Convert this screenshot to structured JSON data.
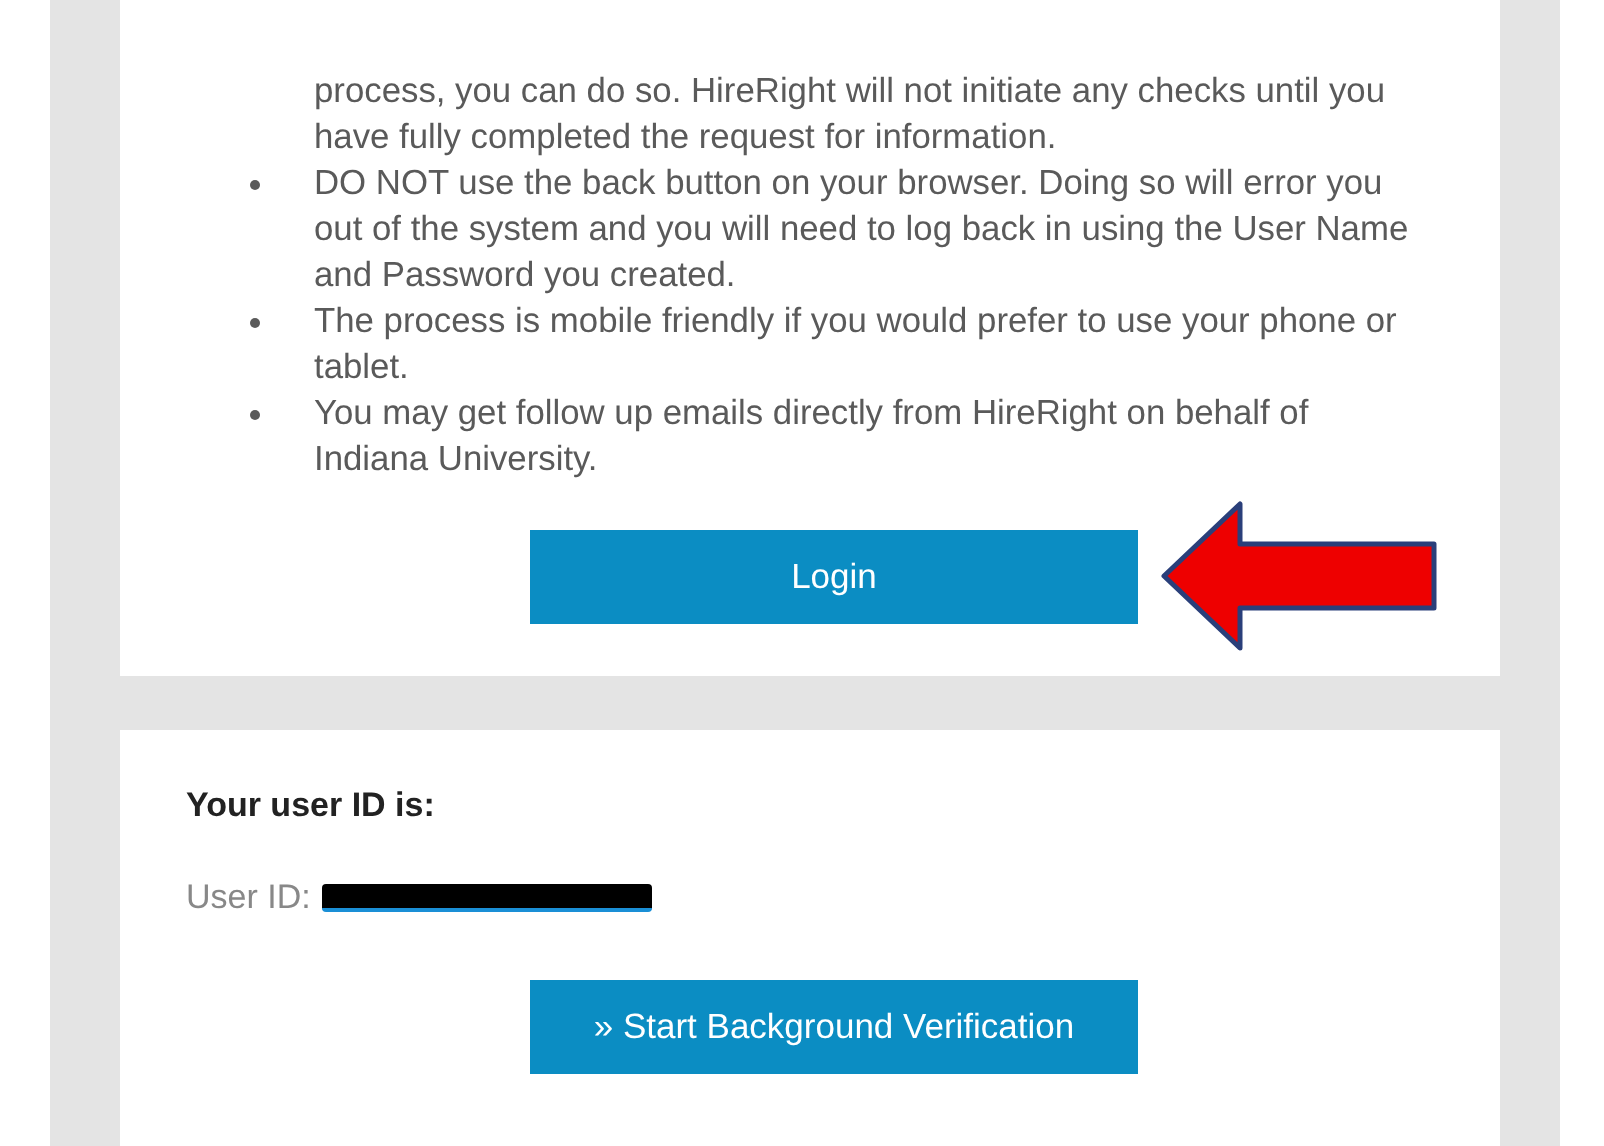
{
  "instructions": [
    {
      "text": "process, you can do so. HireRight will not initiate any checks until you have fully completed the request for information.",
      "bullet_shown": false
    },
    {
      "text": "DO NOT use the back button on your browser. Doing so will error you out of the system and you will need to log back in using the User Name and Password you created.",
      "bullet_shown": true
    },
    {
      "text": "The process is mobile friendly if you would prefer to use your phone or tablet.",
      "bullet_shown": true
    },
    {
      "text": "You may get follow up emails directly from HireRight on behalf of Indiana University.",
      "bullet_shown": true
    }
  ],
  "login_button": {
    "label": "Login"
  },
  "annotation_arrow": {
    "kind": "arrow",
    "color": "#ee0000"
  },
  "user_id_card": {
    "heading": "Your user ID is:",
    "label": "User ID:",
    "redacted": true,
    "button": "» Start Background Verification"
  }
}
